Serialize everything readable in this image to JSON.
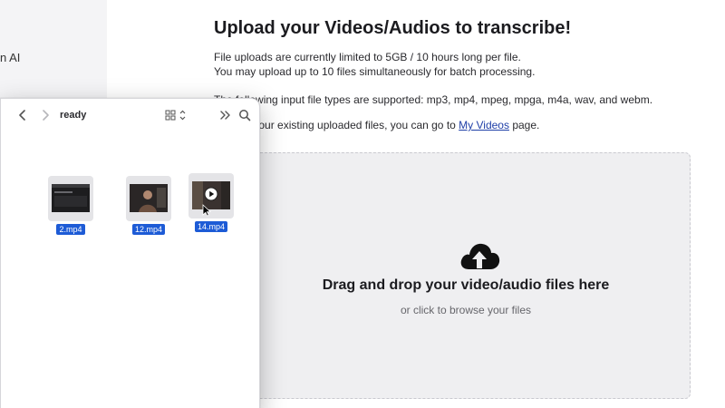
{
  "sidebar": {
    "partial_text": "n AI"
  },
  "main": {
    "title": "Upload your Videos/Audios to transcribe!",
    "info_line_1": "File uploads are currently limited to 5GB / 10 hours long per file.",
    "info_line_2": "You may upload up to 10 files simultaneously for batch processing.",
    "info_line_3": "The following input file types are supported: mp3, mp4, mpeg, mpga, m4a, wav, and webm.",
    "info_line_4_prefix": "To view your existing uploaded files, you can go to ",
    "info_line_4_link": "My Videos",
    "info_line_4_suffix": " page."
  },
  "dropzone": {
    "title": "Drag and drop your video/audio files here",
    "subtitle": "or click to browse your files",
    "icon": "cloud-upload-icon"
  },
  "finder": {
    "folder_name": "ready",
    "toolbar_icons": [
      "chevron-left-icon",
      "chevron-right-icon",
      "grid-view-icon",
      "double-chevron-right-icon",
      "search-icon"
    ],
    "files": [
      {
        "name": "2.mp4"
      },
      {
        "name": "12.mp4"
      },
      {
        "name": "14.mp4"
      }
    ]
  },
  "colors": {
    "accent": "#1d5bd6",
    "link": "#1f3fa8",
    "dropzone_bg": "#efeff1",
    "sidebar_bg": "#f4f4f6"
  }
}
